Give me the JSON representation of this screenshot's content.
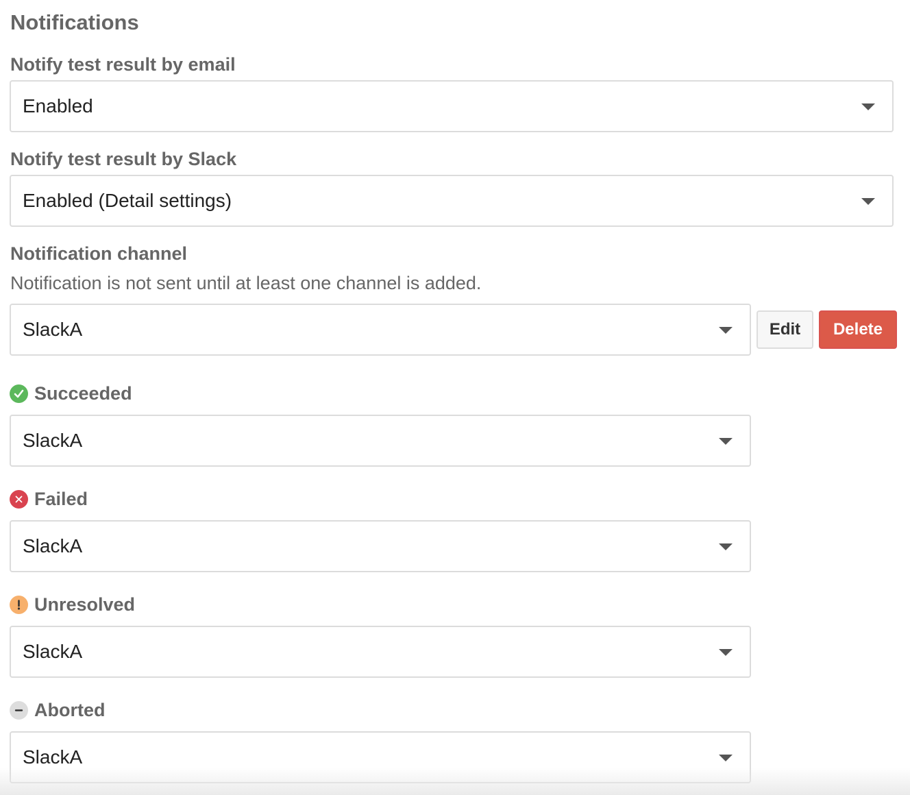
{
  "section": {
    "title": "Notifications"
  },
  "email": {
    "label": "Notify test result by email",
    "value": "Enabled"
  },
  "slack": {
    "label": "Notify test result by Slack",
    "value": "Enabled (Detail settings)"
  },
  "channel": {
    "label": "Notification channel",
    "help": "Notification is not sent until at least one channel is added.",
    "value": "SlackA",
    "edit_label": "Edit",
    "delete_label": "Delete"
  },
  "statuses": {
    "succeeded": {
      "label": "Succeeded",
      "value": "SlackA",
      "icon": "check-circle-icon",
      "color": "#5cb85c"
    },
    "failed": {
      "label": "Failed",
      "value": "SlackA",
      "icon": "x-circle-icon",
      "color": "#d9434f"
    },
    "unresolved": {
      "label": "Unresolved",
      "value": "SlackA",
      "icon": "exclamation-circle-icon",
      "color": "#f7b06c"
    },
    "aborted": {
      "label": "Aborted",
      "value": "SlackA",
      "icon": "minus-circle-icon",
      "color": "#dddddd"
    }
  },
  "colors": {
    "delete_button": "#dc5a49",
    "label_text": "#666666"
  }
}
